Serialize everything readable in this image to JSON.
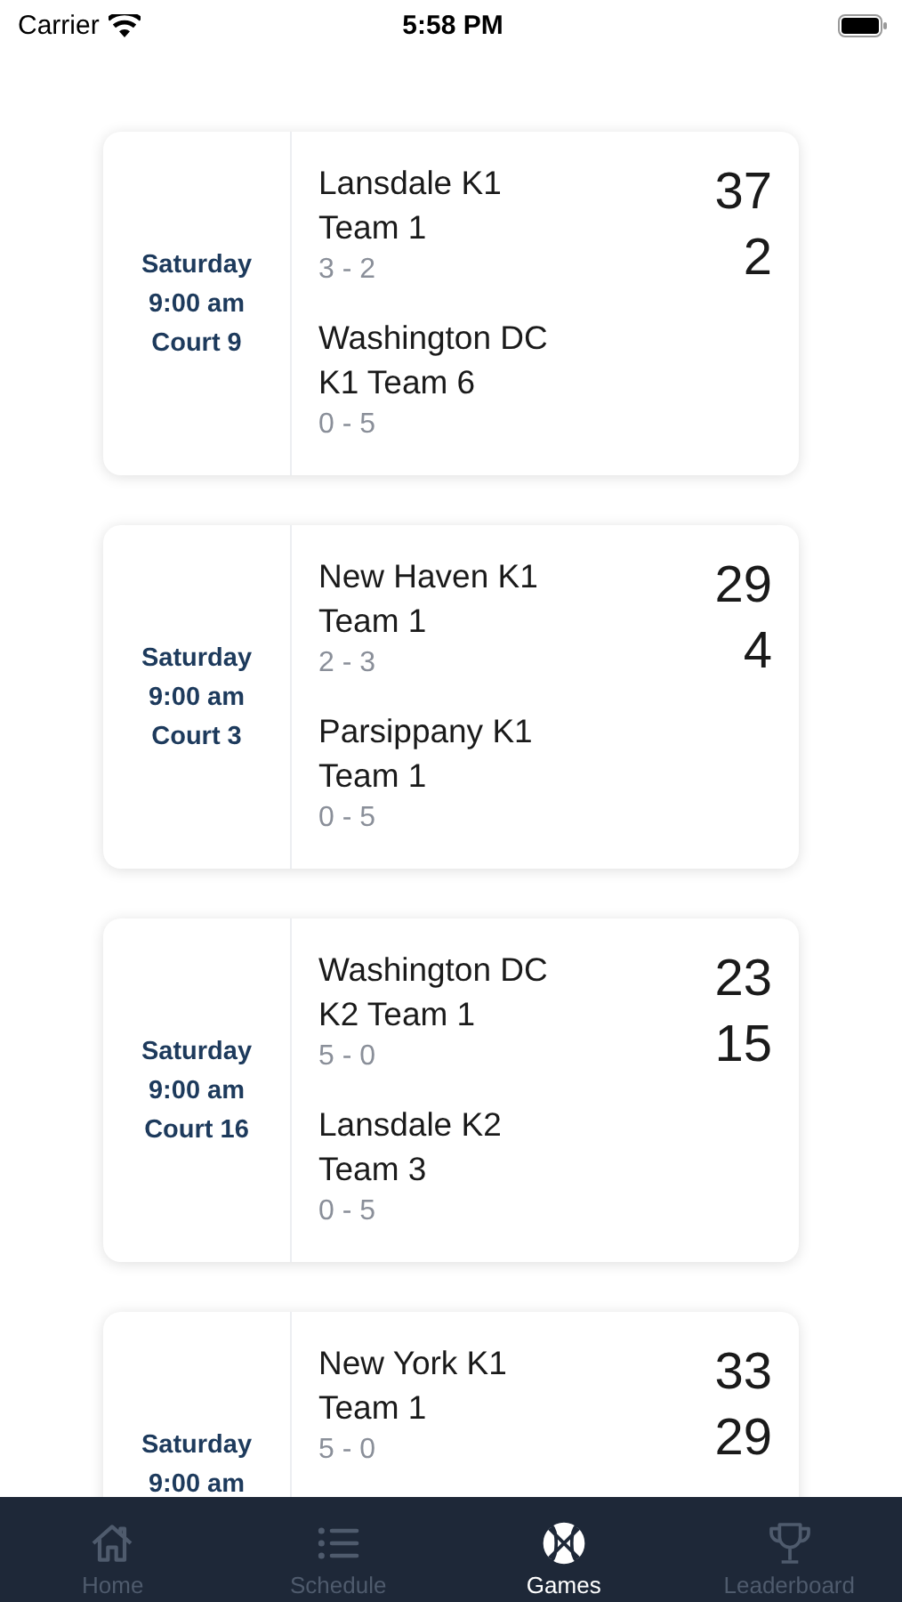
{
  "status_bar": {
    "carrier": "Carrier",
    "time": "5:58 PM"
  },
  "games": [
    {
      "day": "Saturday",
      "time": "9:00 am",
      "court": "Court 9",
      "teams": [
        {
          "name": "Lansdale K1 Team 1",
          "record": "3 - 2",
          "score": "37"
        },
        {
          "name": "Washington DC K1 Team 6",
          "record": "0 - 5",
          "score": "2"
        }
      ]
    },
    {
      "day": "Saturday",
      "time": "9:00 am",
      "court": "Court 3",
      "teams": [
        {
          "name": "New Haven K1 Team 1",
          "record": "2 - 3",
          "score": "29"
        },
        {
          "name": "Parsippany K1 Team 1",
          "record": "0 - 5",
          "score": "4"
        }
      ]
    },
    {
      "day": "Saturday",
      "time": "9:00 am",
      "court": "Court 16",
      "teams": [
        {
          "name": "Washington DC K2 Team 1",
          "record": "5 - 0",
          "score": "23"
        },
        {
          "name": "Lansdale K2 Team 3",
          "record": "0 - 5",
          "score": "15"
        }
      ]
    },
    {
      "day": "Saturday",
      "time": "9:00 am",
      "teams": [
        {
          "name": "New York K1 Team 1",
          "record": "5 - 0",
          "score": "33"
        },
        {
          "score": "29"
        }
      ]
    }
  ],
  "tabs": [
    {
      "label": "Home",
      "kind": "home",
      "selected": false
    },
    {
      "label": "Schedule",
      "kind": "list",
      "selected": false
    },
    {
      "label": "Games",
      "kind": "ball",
      "selected": true
    },
    {
      "label": "Leaderboard",
      "kind": "trophy",
      "selected": false
    }
  ]
}
